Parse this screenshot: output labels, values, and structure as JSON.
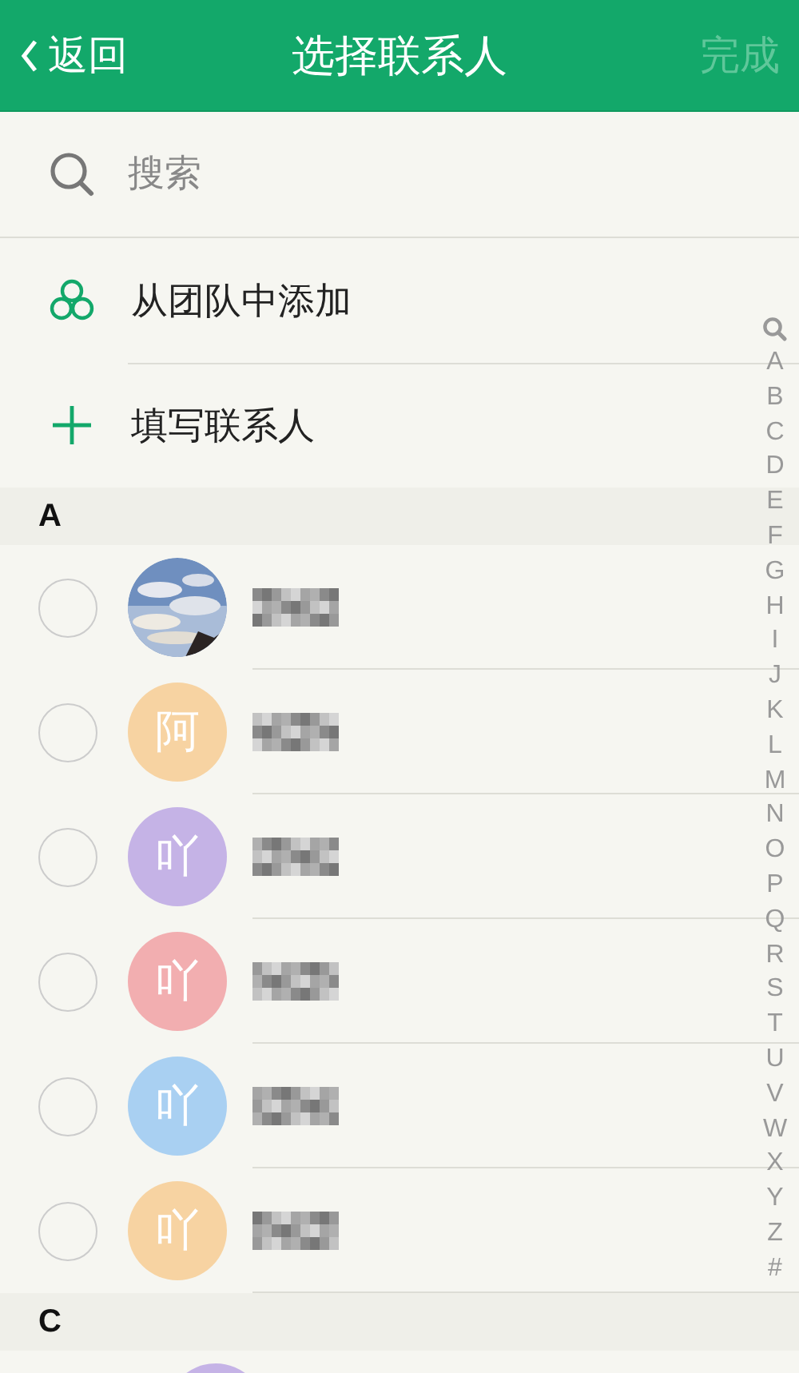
{
  "nav_bar": {
    "back": "返回",
    "title": "选择联系人",
    "done": "完成",
    "done_disabled": true
  },
  "search": {
    "placeholder": "搜索"
  },
  "actions": [
    {
      "kind": "team",
      "label": "从团队中添加"
    },
    {
      "kind": "add",
      "label": "填写联系人"
    }
  ],
  "sections": [
    {
      "header": "A",
      "contacts": [
        {
          "selected": false
        },
        {
          "avatar": {
            "kind": "letter",
            "char": "阿",
            "color": "#f7d3a2"
          },
          "selected": false
        },
        {
          "avatar": {
            "kind": "letter",
            "char": "吖",
            "color": "#c5b3e6"
          },
          "selected": false
        },
        {
          "avatar": {
            "kind": "letter",
            "char": "吖",
            "color": "#f2aeb0"
          },
          "selected": false
        },
        {
          "avatar": {
            "kind": "letter",
            "char": "吖",
            "color": "#a9d0f2"
          },
          "selected": false
        },
        {
          "avatar": {
            "kind": "letter",
            "char": "吖",
            "color": "#f7d3a2"
          },
          "selected": false
        }
      ]
    },
    {
      "header": "C",
      "contacts": [
        {
          "avatar": {
            "kind": "letter",
            "color": "#c5b3e6"
          }
        }
      ]
    }
  ],
  "index": [
    "A",
    "B",
    "C",
    "D",
    "E",
    "F",
    "G",
    "H",
    "I",
    "J",
    "K",
    "L",
    "M",
    "N",
    "O",
    "P",
    "Q",
    "R",
    "S",
    "T",
    "U",
    "V",
    "W",
    "X",
    "Y",
    "Z",
    "#"
  ]
}
